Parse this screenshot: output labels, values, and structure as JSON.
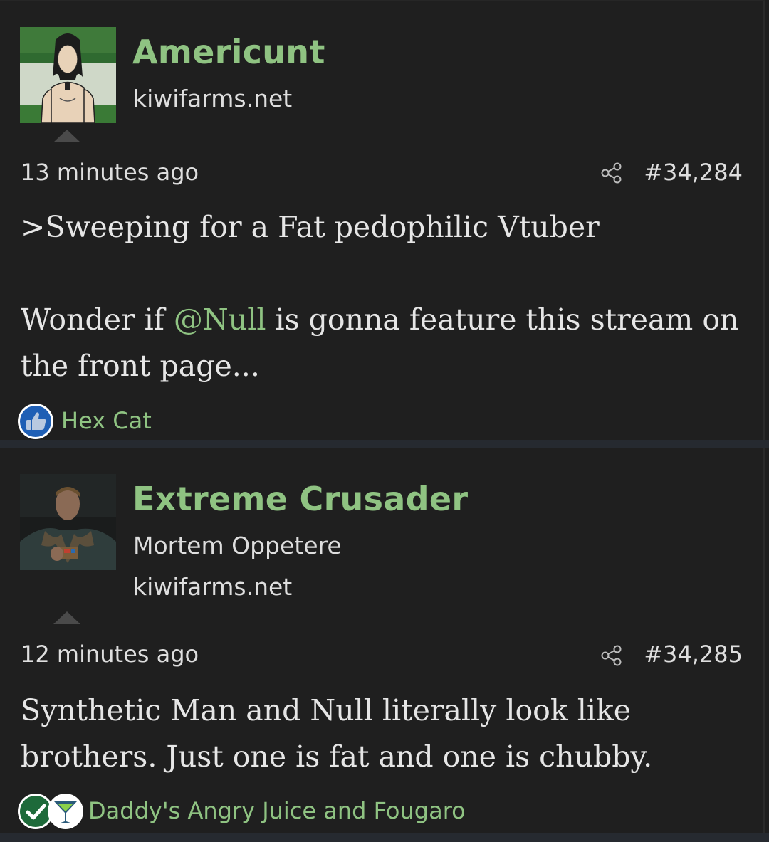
{
  "posts": [
    {
      "username": "Americunt",
      "user_lines": [
        "kiwifarms.net"
      ],
      "time": "13 minutes ago",
      "post_number": "#34,284",
      "body": [
        {
          "text": ">Sweeping for a Fat pedophilic Vtuber"
        },
        {
          "prefix": "Wonder if ",
          "mention": "@Null",
          "suffix": " is gonna feature this stream on the front page..."
        }
      ],
      "reactions": {
        "icons": [
          "thumbs-up-icon"
        ],
        "names": "Hex Cat"
      }
    },
    {
      "username": "Extreme Crusader",
      "user_lines": [
        "Mortem Oppetere",
        "kiwifarms.net"
      ],
      "time": "12 minutes ago",
      "post_number": "#34,285",
      "body": [
        {
          "text": "Synthetic Man and Null literally look like brothers. Just one is fat and one is chubby."
        }
      ],
      "reactions": {
        "icons": [
          "checkmark-icon",
          "cocktail-glass-icon"
        ],
        "names": "Daddy's Angry Juice and Fougaro"
      }
    }
  ],
  "colors": {
    "background": "#1f1f1f",
    "username": "#8fc382",
    "text": "#e6e6e6",
    "separator": "#262a30",
    "like_blue": "#1f5fb5",
    "check_green": "#1e6a3a"
  }
}
